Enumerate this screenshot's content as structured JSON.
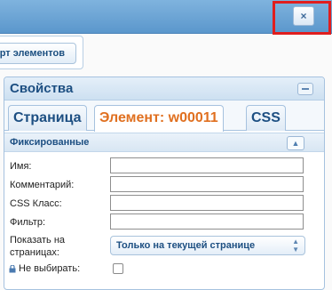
{
  "window": {
    "close_label": "×"
  },
  "toolbar": {
    "export_label": "рт элементов"
  },
  "panel": {
    "title": "Свойства",
    "tabs": [
      {
        "label": "Страница"
      },
      {
        "label": "Элемент: w00011"
      },
      {
        "label": "CSS"
      }
    ],
    "section_title": "Фиксированные",
    "fields": {
      "name_label": "Имя:",
      "comment_label": "Комментарий:",
      "css_class_label": "CSS Класс:",
      "filter_label": "Фильтр:",
      "show_on_pages_label": "Показать на страницах:",
      "show_on_pages_value": "Только на текущей странице",
      "no_select_label": "Не выбирать:"
    }
  }
}
